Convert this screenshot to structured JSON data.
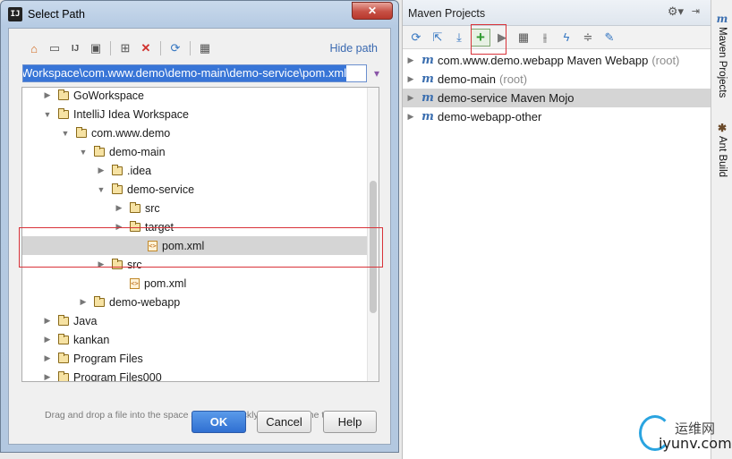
{
  "dialog": {
    "title": "Select Path",
    "close_icon": "close-icon",
    "toolbar_icons": [
      "home-icon",
      "desktop-icon",
      "project-icon",
      "module-icon",
      "new-folder-icon",
      "delete-icon",
      "refresh-icon",
      "show-hidden-icon"
    ],
    "hide_path": "Hide path",
    "path_value": "Workspace\\com.www.demo\\demo-main\\demo-service\\pom.xml",
    "hint": "Drag and drop a file into the space above to quickly locate it in the tree.",
    "ok": "OK",
    "cancel": "Cancel",
    "help": "Help"
  },
  "tree": [
    {
      "label": "GoWorkspace",
      "indent": 1,
      "arrow": "right",
      "type": "folder"
    },
    {
      "label": "IntelliJ Idea Workspace",
      "indent": 1,
      "arrow": "down",
      "type": "folder"
    },
    {
      "label": "com.www.demo",
      "indent": 2,
      "arrow": "down",
      "type": "folder"
    },
    {
      "label": "demo-main",
      "indent": 3,
      "arrow": "down",
      "type": "folder"
    },
    {
      "label": ".idea",
      "indent": 4,
      "arrow": "right",
      "type": "folder"
    },
    {
      "label": "demo-service",
      "indent": 4,
      "arrow": "down",
      "type": "folder"
    },
    {
      "label": "src",
      "indent": 5,
      "arrow": "right",
      "type": "folder"
    },
    {
      "label": "target",
      "indent": 5,
      "arrow": "right",
      "type": "folder"
    },
    {
      "label": "pom.xml",
      "indent": 6,
      "arrow": "",
      "type": "xml",
      "selected": true
    },
    {
      "label": "src",
      "indent": 4,
      "arrow": "right",
      "type": "folder"
    },
    {
      "label": "pom.xml",
      "indent": 5,
      "arrow": "",
      "type": "xml"
    },
    {
      "label": "demo-webapp",
      "indent": 3,
      "arrow": "right",
      "type": "folder"
    },
    {
      "label": "Java",
      "indent": 1,
      "arrow": "right",
      "type": "folder"
    },
    {
      "label": "kankan",
      "indent": 1,
      "arrow": "right",
      "type": "folder"
    },
    {
      "label": "Program Files",
      "indent": 1,
      "arrow": "right",
      "type": "folder"
    },
    {
      "label": "Program Files000",
      "indent": 1,
      "arrow": "right",
      "type": "folder"
    }
  ],
  "maven": {
    "title": "Maven Projects",
    "gear_icon": "gear-icon",
    "hide_icon": "hide-panel-icon",
    "toolbar": [
      {
        "name": "reimport-icon",
        "glyph": "⟳"
      },
      {
        "name": "generate-sources-icon",
        "glyph": "⇱"
      },
      {
        "name": "download-icon",
        "glyph": "⤓"
      },
      {
        "name": "add-maven-project-icon",
        "glyph": "+",
        "add": true
      },
      {
        "name": "run-icon",
        "glyph": "▶"
      },
      {
        "name": "execute-goal-icon",
        "glyph": "▦"
      },
      {
        "name": "toggle-offline-icon",
        "glyph": "⫲"
      },
      {
        "name": "skip-tests-icon",
        "glyph": "ϟ"
      },
      {
        "name": "collapse-all-icon",
        "glyph": "≑"
      },
      {
        "name": "settings-icon",
        "glyph": "✎"
      }
    ],
    "projects": [
      {
        "label": "com.www.demo.webapp Maven Webapp",
        "suffix": "(root)"
      },
      {
        "label": "demo-main",
        "suffix": "(root)"
      },
      {
        "label": "demo-service Maven Mojo",
        "suffix": "",
        "selected": true
      },
      {
        "label": "demo-webapp-other",
        "suffix": ""
      }
    ]
  },
  "side_tabs": [
    {
      "label": "Maven Projects",
      "icon": "maven-icon"
    },
    {
      "label": "Ant Build",
      "icon": "ant-icon"
    }
  ],
  "watermark": {
    "cn": "运维网",
    "url": "iyunv.com"
  }
}
